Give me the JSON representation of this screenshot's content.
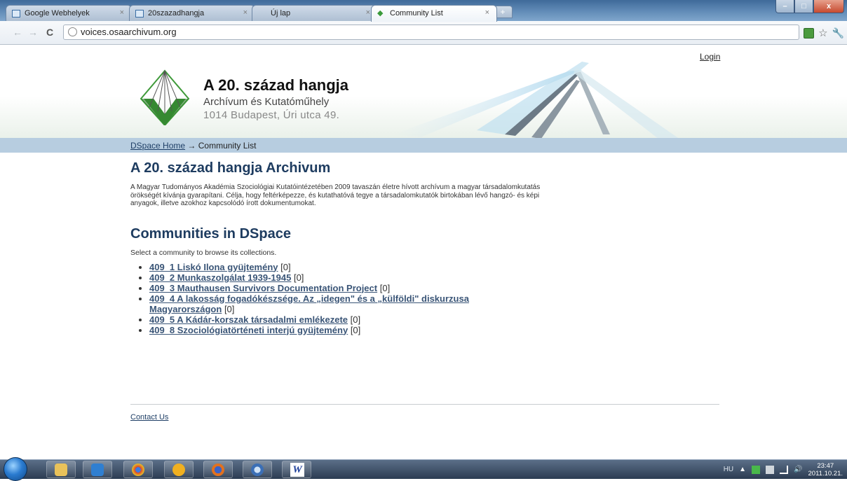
{
  "browser": {
    "tabs": [
      {
        "title": "Google Webhelyek"
      },
      {
        "title": "20szazadhangja"
      },
      {
        "title": "Új lap"
      },
      {
        "title": "Community List"
      }
    ],
    "close_glyph": "×",
    "new_tab_glyph": "+",
    "url": "voices.osaarchivum.org",
    "window_buttons": {
      "minimize": "–",
      "maximize": "□",
      "close": "x"
    },
    "nav_icons": {
      "back": "←",
      "forward": "→",
      "reload": "C"
    }
  },
  "header": {
    "login": "Login",
    "title": "A 20. század hangja",
    "subtitle": "Archívum és Kutatóműhely",
    "address": "1014 Budapest, Úri utca 49."
  },
  "breadcrumb": {
    "home": "DSpace Home",
    "separator": "→",
    "current": "Community List"
  },
  "main": {
    "archive_title": "A 20. század hangja Archivum",
    "archive_description": "A Magyar Tudományos Akadémia Szociológiai Kutatóintézetében 2009 tavaszán életre hívott archívum a magyar társadalomkutatás örökségét kívánja gyarapítani. Célja, hogy feltérképezze, és kutathatóvá tegye a társadalomkutatók birtokában lévő hangzó- és képi anyagok, illetve azokhoz kapcsolódó írott dokumentumokat.",
    "communities_title": "Communities in DSpace",
    "communities_subtitle": "Select a community to browse its collections.",
    "communities": [
      {
        "name": "409_1 Liskó Ilona gyüjtemény",
        "count": "[0]"
      },
      {
        "name": "409_2 Munkaszolgálat 1939-1945",
        "count": "[0]"
      },
      {
        "name": "409_3 Mauthausen Survivors Documentation Project",
        "count": "[0]"
      },
      {
        "name": "409_4 A lakosság fogadókészsége. Az „idegen\" és a „külföldi\" diskurzusa Magyarországon",
        "count": "[0]"
      },
      {
        "name": "409_5 A Kádár-korszak társadalmi emlékezete",
        "count": "[0]"
      },
      {
        "name": "409_8 Szociológiatörténeti interjú gyüjtemény",
        "count": "[0]"
      }
    ]
  },
  "footer": {
    "contact": "Contact Us"
  },
  "taskbar": {
    "language": "HU",
    "tray_arrow": "▲",
    "time": "23:47",
    "date": "2011.10.21."
  },
  "colors": {
    "heading": "#1e3c60",
    "link": "#3a5577",
    "breadcrumb_bar": "#b7cde0",
    "logo_green": "#3f9a3a"
  }
}
